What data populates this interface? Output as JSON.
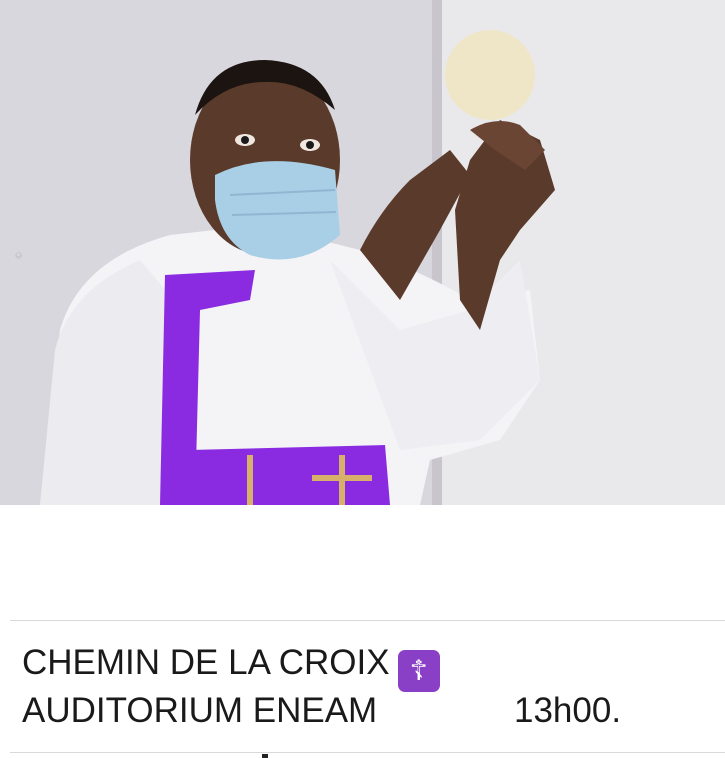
{
  "photo": {
    "alt_icon": "photo-priest-elevating-host",
    "colors": {
      "wall": "#d6d5dc",
      "alb": "#f4f3f6",
      "stole": "#8a2be2",
      "host": "#efe6c8",
      "mask": "#a9cfe6",
      "skin": "#5a3a2a"
    }
  },
  "caption": {
    "line1": "CHEMIN DE LA CROIX",
    "cross_emoji": "☦",
    "line2": "AUDITORIUM ENEAM",
    "time": "13h00."
  }
}
